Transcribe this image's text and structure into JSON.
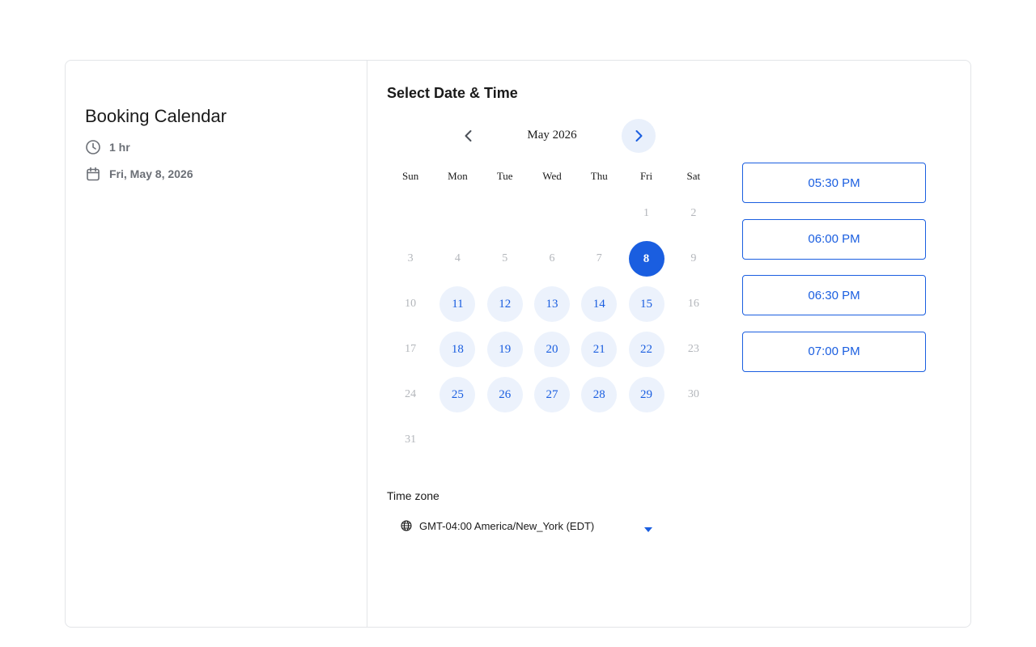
{
  "event": {
    "title": "Booking Calendar",
    "duration": "1 hr",
    "date": "Fri, May 8, 2026"
  },
  "picker": {
    "title": "Select Date & Time",
    "month_label": "May 2026",
    "weekdays": [
      "Sun",
      "Mon",
      "Tue",
      "Wed",
      "Thu",
      "Fri",
      "Sat"
    ],
    "weeks": [
      [
        null,
        null,
        null,
        null,
        null,
        {
          "n": "1",
          "s": "off"
        },
        {
          "n": "2",
          "s": "off"
        }
      ],
      [
        {
          "n": "3",
          "s": "off"
        },
        {
          "n": "4",
          "s": "off"
        },
        {
          "n": "5",
          "s": "off"
        },
        {
          "n": "6",
          "s": "off"
        },
        {
          "n": "7",
          "s": "off"
        },
        {
          "n": "8",
          "s": "selected"
        },
        {
          "n": "9",
          "s": "off"
        }
      ],
      [
        {
          "n": "10",
          "s": "off"
        },
        {
          "n": "11",
          "s": "avail"
        },
        {
          "n": "12",
          "s": "avail"
        },
        {
          "n": "13",
          "s": "avail"
        },
        {
          "n": "14",
          "s": "avail"
        },
        {
          "n": "15",
          "s": "avail"
        },
        {
          "n": "16",
          "s": "off"
        }
      ],
      [
        {
          "n": "17",
          "s": "off"
        },
        {
          "n": "18",
          "s": "avail"
        },
        {
          "n": "19",
          "s": "avail"
        },
        {
          "n": "20",
          "s": "avail"
        },
        {
          "n": "21",
          "s": "avail"
        },
        {
          "n": "22",
          "s": "avail"
        },
        {
          "n": "23",
          "s": "off"
        }
      ],
      [
        {
          "n": "24",
          "s": "off"
        },
        {
          "n": "25",
          "s": "avail"
        },
        {
          "n": "26",
          "s": "avail"
        },
        {
          "n": "27",
          "s": "avail"
        },
        {
          "n": "28",
          "s": "avail"
        },
        {
          "n": "29",
          "s": "avail"
        },
        {
          "n": "30",
          "s": "off"
        }
      ],
      [
        {
          "n": "31",
          "s": "off"
        },
        null,
        null,
        null,
        null,
        null,
        null
      ]
    ]
  },
  "slots": [
    "05:30 PM",
    "06:00 PM",
    "06:30 PM",
    "07:00 PM"
  ],
  "timezone": {
    "label": "Time zone",
    "value": "GMT-04:00 America/New_York (EDT)"
  },
  "icons": {
    "duration": "clock-icon",
    "date": "calendar-icon",
    "prev": "chevron-left-icon",
    "next": "chevron-right-icon",
    "timezone": "globe-icon",
    "dropdown": "caret-down-icon"
  },
  "colors": {
    "accent": "#1a5ee0",
    "available_bg": "#ecf2fc",
    "muted_day": "#b3b6bb",
    "meta_text": "#6b6f76",
    "border": "#e3e5e8"
  }
}
